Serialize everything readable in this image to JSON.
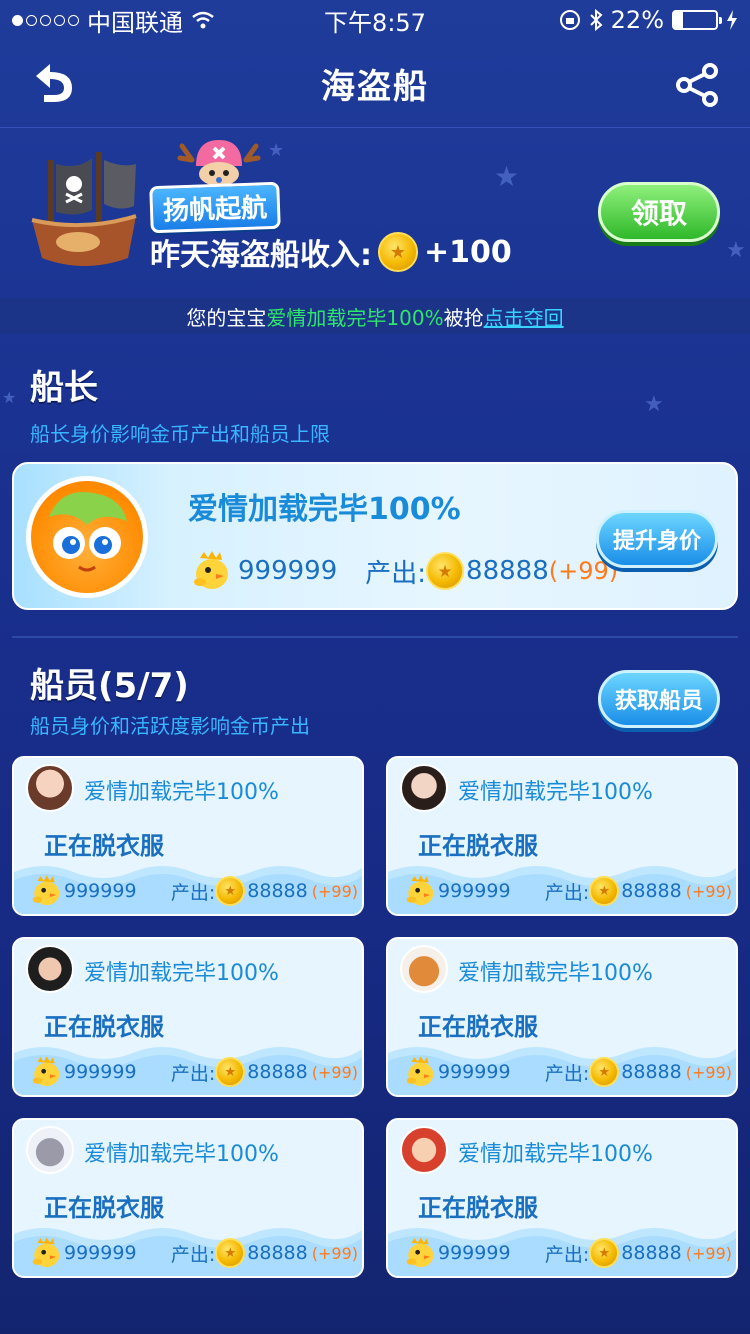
{
  "status_bar": {
    "carrier": "中国联通",
    "time": "下午8:57",
    "battery": "22%",
    "battery_level": 0.22
  },
  "nav": {
    "title": "海盗船"
  },
  "banner": {
    "slogan": "扬帆起航",
    "income_label": "昨天海盗船收入:",
    "income_value": "+100",
    "claim_label": "领取",
    "notice_prefix": "您的宝宝",
    "notice_highlight": "爱情加载完毕100%",
    "notice_mid": "被抢",
    "notice_link": "点击夺回"
  },
  "captain": {
    "title": "船长",
    "subtitle": "船长身价影响金币产出和船员上限",
    "name": "爱情加载完毕100%",
    "worth": "999999",
    "output_label": "产出:",
    "output": "88888",
    "bonus": "(+99)",
    "upgrade_label": "提升身价"
  },
  "crew": {
    "title": "船员(5/7)",
    "subtitle": "船员身价和活跃度影响金币产出",
    "get_label": "获取船员",
    "members": [
      {
        "name": "爱情加载完毕100%",
        "status": "正在脱衣服",
        "worth": "999999",
        "output_label": "产出:",
        "output": "88888",
        "bonus": "(+99)"
      },
      {
        "name": "爱情加载完毕100%",
        "status": "正在脱衣服",
        "worth": "999999",
        "output_label": "产出:",
        "output": "88888",
        "bonus": "(+99)"
      },
      {
        "name": "爱情加载完毕100%",
        "status": "正在脱衣服",
        "worth": "999999",
        "output_label": "产出:",
        "output": "88888",
        "bonus": "(+99)"
      },
      {
        "name": "爱情加载完毕100%",
        "status": "正在脱衣服",
        "worth": "999999",
        "output_label": "产出:",
        "output": "88888",
        "bonus": "(+99)"
      },
      {
        "name": "爱情加载完毕100%",
        "status": "正在脱衣服",
        "worth": "999999",
        "output_label": "产出:",
        "output": "88888",
        "bonus": "(+99)"
      },
      {
        "name": "爱情加载完毕100%",
        "status": "正在脱衣服",
        "worth": "999999",
        "output_label": "产出:",
        "output": "88888",
        "bonus": "(+99)"
      }
    ]
  },
  "colors": {
    "accent_green": "#2ee66b",
    "link_cyan": "#38d4ff",
    "bonus_orange": "#ff7a1a"
  }
}
